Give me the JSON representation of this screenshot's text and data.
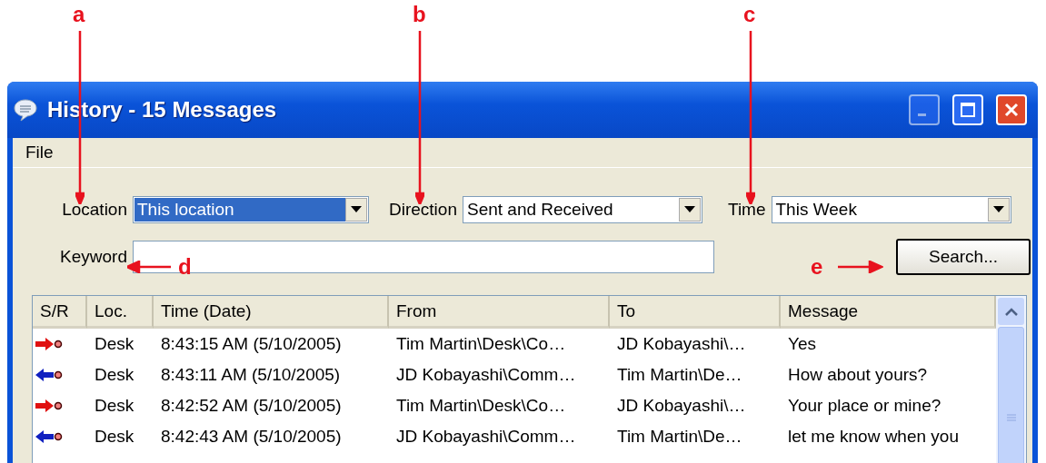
{
  "annotations": [
    {
      "label": "a",
      "kind": "down"
    },
    {
      "label": "b",
      "kind": "down"
    },
    {
      "label": "c",
      "kind": "down"
    },
    {
      "label": "d",
      "kind": "left"
    },
    {
      "label": "e",
      "kind": "right"
    }
  ],
  "window": {
    "title": "History - 15 Messages"
  },
  "menu": [
    "File"
  ],
  "filters": [
    {
      "label": "Location",
      "value": "This location",
      "highlighted": true
    },
    {
      "label": "Direction",
      "value": "Sent and Received",
      "highlighted": false
    },
    {
      "label": "Time",
      "value": "This Week",
      "highlighted": false
    }
  ],
  "keyword": {
    "label": "Keyword"
  },
  "search_button": "Search...",
  "table": {
    "columns": [
      "S/R",
      "Loc.",
      "Time (Date)",
      "From",
      "To",
      "Message"
    ],
    "rows": [
      {
        "kind": "sent",
        "loc": "Desk",
        "time": "8:43:15 AM (5/10/2005)",
        "from": "Tim Martin\\Desk\\Co…",
        "to": "JD Kobayashi\\…",
        "message": "Yes"
      },
      {
        "kind": "received",
        "loc": "Desk",
        "time": "8:43:11 AM (5/10/2005)",
        "from": "JD Kobayashi\\Comm…",
        "to": "Tim Martin\\De…",
        "message": "How about yours?"
      },
      {
        "kind": "sent",
        "loc": "Desk",
        "time": "8:42:52 AM (5/10/2005)",
        "from": "Tim Martin\\Desk\\Co…",
        "to": "JD Kobayashi\\…",
        "message": "Your place or mine?"
      },
      {
        "kind": "received",
        "loc": "Desk",
        "time": "8:42:43 AM (5/10/2005)",
        "from": "JD Kobayashi\\Comm…",
        "to": "Tim Martin\\De…",
        "message": "let me know when you"
      }
    ]
  }
}
